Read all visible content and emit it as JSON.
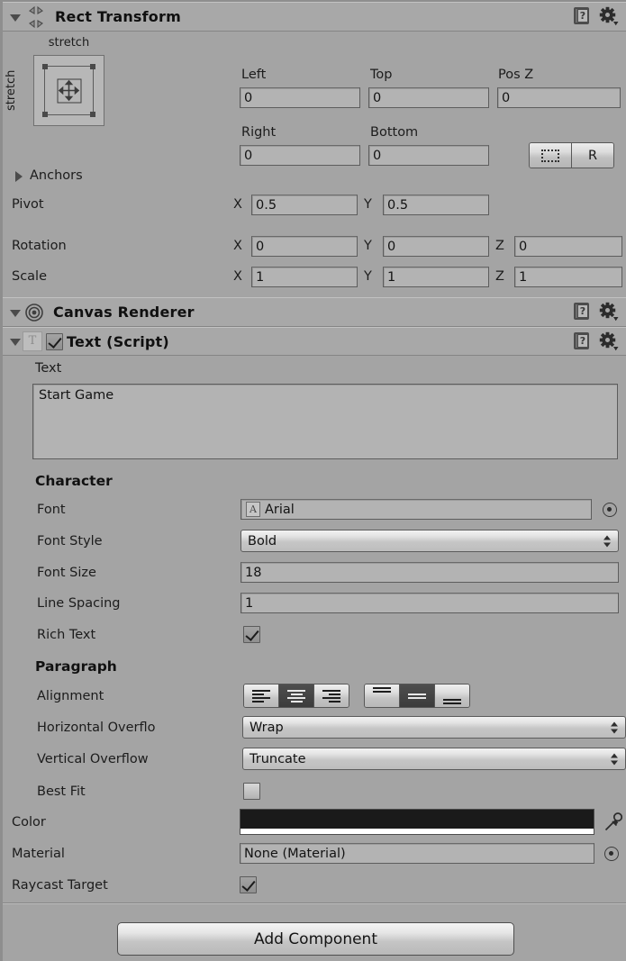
{
  "inspector": {
    "components": [
      {
        "title": "Rect Transform",
        "icon": "rect-transform-icon",
        "anchor_preset": {
          "horizontal_label": "stretch",
          "vertical_label": "stretch"
        },
        "column_headers": [
          "Left",
          "Top",
          "Pos Z",
          "Right",
          "Bottom"
        ],
        "values": {
          "left": "0",
          "top": "0",
          "pos_z": "0",
          "right": "0",
          "bottom": "0"
        },
        "blueprint_buttons": {
          "blueprint_label": "",
          "raw_label": "R"
        },
        "anchors_label": "Anchors",
        "pivot": {
          "label": "Pivot",
          "x_axis": "X",
          "x": "0.5",
          "y_axis": "Y",
          "y": "0.5"
        },
        "rotation": {
          "label": "Rotation",
          "x_axis": "X",
          "x": "0",
          "y_axis": "Y",
          "y": "0",
          "z_axis": "Z",
          "z": "0"
        },
        "scale": {
          "label": "Scale",
          "x_axis": "X",
          "x": "1",
          "y_axis": "Y",
          "y": "1",
          "z_axis": "Z",
          "z": "1"
        }
      },
      {
        "title": "Canvas Renderer",
        "icon": "canvas-renderer-icon"
      },
      {
        "title": "Text (Script)",
        "icon": "text-script-icon",
        "enabled": true,
        "text_field": {
          "label": "Text",
          "value": "Start Game"
        },
        "character": {
          "section_label": "Character",
          "font": {
            "label": "Font",
            "value": "Arial"
          },
          "font_style": {
            "label": "Font Style",
            "value": "Bold"
          },
          "font_size": {
            "label": "Font Size",
            "value": "18"
          },
          "line_spacing": {
            "label": "Line Spacing",
            "value": "1"
          },
          "rich_text": {
            "label": "Rich Text",
            "checked": true
          }
        },
        "paragraph": {
          "section_label": "Paragraph",
          "alignment": {
            "label": "Alignment",
            "horizontal_selected": "center",
            "vertical_selected": "middle"
          },
          "horizontal_overflow": {
            "label": "Horizontal Overflo",
            "value": "Wrap"
          },
          "vertical_overflow": {
            "label": "Vertical Overflow",
            "value": "Truncate"
          },
          "best_fit": {
            "label": "Best Fit",
            "checked": false
          }
        },
        "color": {
          "label": "Color",
          "value": "#000000",
          "alpha_color": "#ffffff"
        },
        "material": {
          "label": "Material",
          "value": "None (Material)"
        },
        "raycast_target": {
          "label": "Raycast Target",
          "checked": true
        }
      }
    ],
    "add_component_label": "Add Component",
    "help_icon_glyph": "?",
    "theme": {
      "panel_bg": "#a4a4a4",
      "header_bg": "#a8a8a8",
      "field_bg": "#b3b3b3",
      "text": "#1a1a1a"
    }
  }
}
